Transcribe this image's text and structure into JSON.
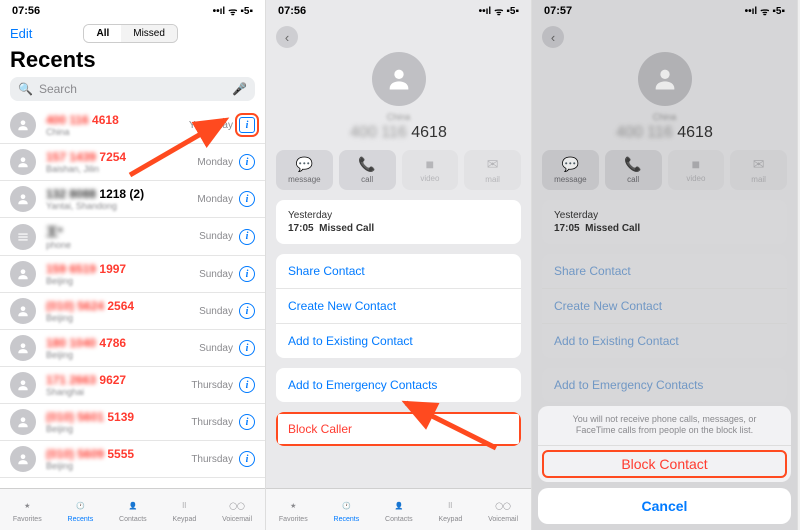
{
  "status": {
    "time1": "07:56",
    "time2": "07:56",
    "time3": "07:57",
    "signal": "▪▪▪▪",
    "wifi": "⌃",
    "batt": "▮5▮"
  },
  "screen1": {
    "edit": "Edit",
    "seg_all": "All",
    "seg_missed": "Missed",
    "title": "Recents",
    "search_placeholder": "Search",
    "rows": [
      {
        "name_pre": "400 116",
        "name_clear": " 4618",
        "sub": "China",
        "date": "Yesterday",
        "red": true
      },
      {
        "name_pre": "157 1439",
        "name_clear": " 7254",
        "sub": "Baishan, Jilin",
        "date": "Monday",
        "red": true
      },
      {
        "name_pre": "132 8088",
        "name_clear": " 1218 (2)",
        "sub": "Yantai, Shandong",
        "date": "Monday",
        "red": false
      },
      {
        "name_pre": "王*",
        "name_clear": "",
        "sub": "phone",
        "date": "Sunday",
        "red": false,
        "bars": true
      },
      {
        "name_pre": "159 6519",
        "name_clear": " 1997",
        "sub": "Beijing",
        "date": "Sunday",
        "red": true
      },
      {
        "name_pre": "(010) 5624",
        "name_clear": " 2564",
        "sub": "Beijing",
        "date": "Sunday",
        "red": true
      },
      {
        "name_pre": "180 1040",
        "name_clear": " 4786",
        "sub": "Beijing",
        "date": "Sunday",
        "red": true
      },
      {
        "name_pre": "171 2663",
        "name_clear": " 9627",
        "sub": "Shanghai",
        "date": "Thursday",
        "red": true
      },
      {
        "name_pre": "(010) 5601",
        "name_clear": " 5139",
        "sub": "Beijing",
        "date": "Thursday",
        "red": true
      },
      {
        "name_pre": "(010) 5609",
        "name_clear": " 5555",
        "sub": "Beijing",
        "date": "Thursday",
        "red": true
      }
    ],
    "tabs": [
      "Favorites",
      "Recents",
      "Contacts",
      "Keypad",
      "Voicemail"
    ]
  },
  "detail": {
    "number_blur": "400 116",
    "number_clear": " 4618",
    "actions": [
      "message",
      "call",
      "video",
      "mail"
    ],
    "hist_label": "Yesterday",
    "hist_time": "17:05",
    "hist_type": "Missed Call",
    "share": "Share Contact",
    "create": "Create New Contact",
    "addexist": "Add to Existing Contact",
    "emergency": "Add to Emergency Contacts",
    "block": "Block Caller"
  },
  "sheet": {
    "msg": "You will not receive phone calls, messages, or FaceTime calls from people on the block list.",
    "action": "Block Contact",
    "cancel": "Cancel"
  }
}
